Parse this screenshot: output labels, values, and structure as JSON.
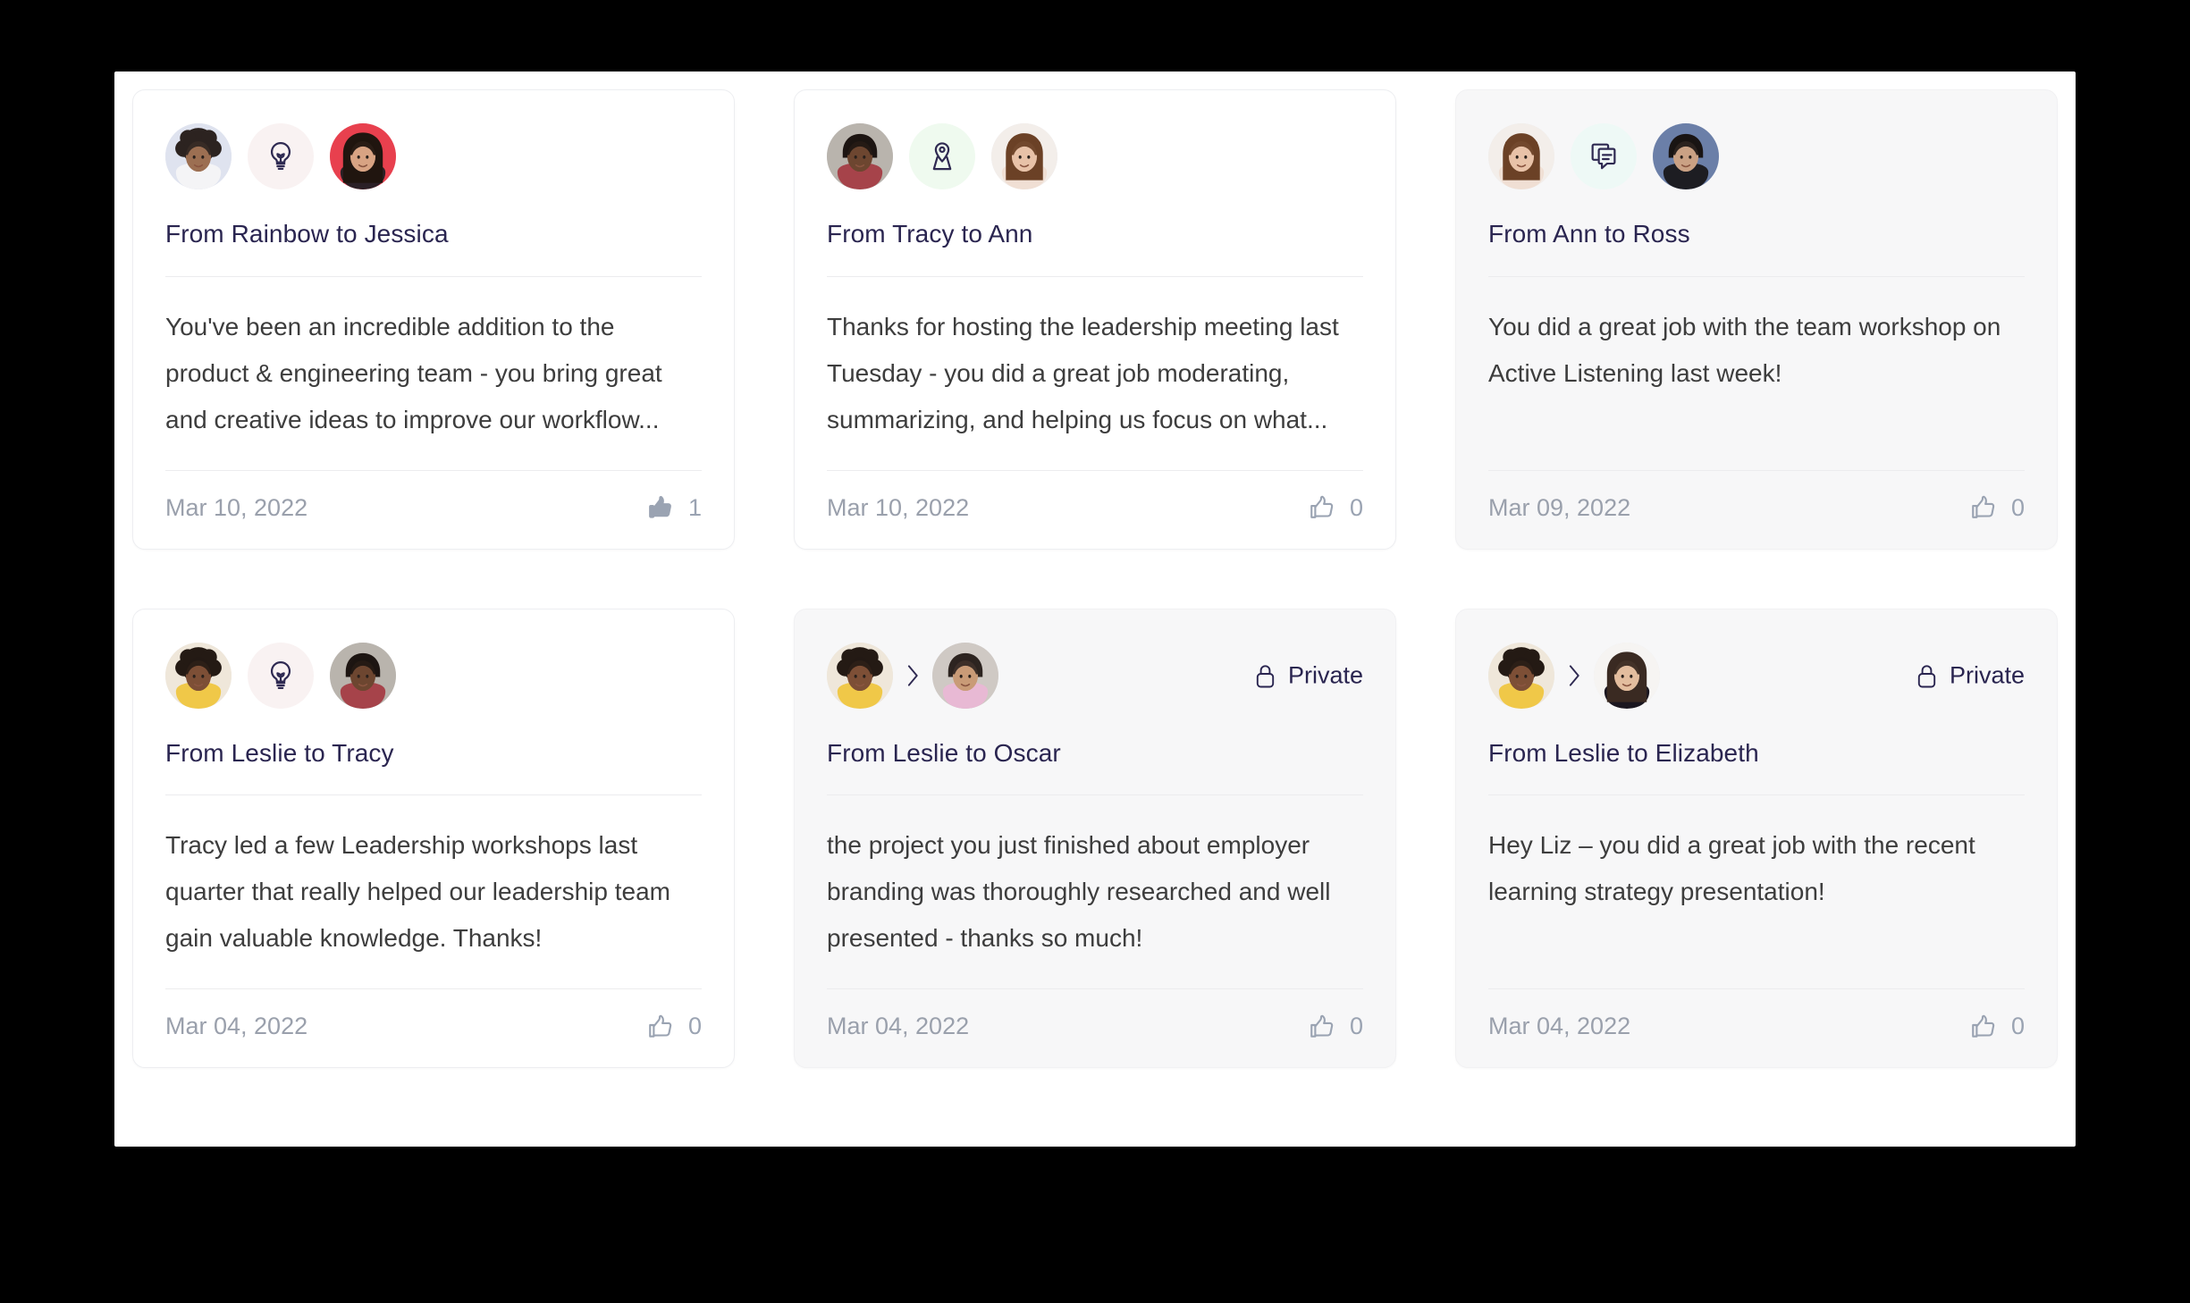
{
  "theme": {
    "page_background": "#000000",
    "panel_background": "#ffffff",
    "card_background": "#ffffff",
    "card_background_tinted": "#f7f7f8",
    "title_color": "#2a2550",
    "body_color": "#3d3d3d",
    "muted_color": "#9aa0ac",
    "like_color": "#9aa3b2"
  },
  "cards": [
    {
      "id": "card-rainbow-jessica",
      "title": "From Rainbow to Jessica",
      "body": "You've been an incredible addition to the product & engineering team - you bring great and creative ideas to improve our workflow...",
      "date": "Mar 10, 2022",
      "like_count": "1",
      "like_state": "liked",
      "like_icon": "thumbs-up-filled-icon",
      "badge_icon": "lightbulb-icon",
      "badge_bg": "#f9f2f2",
      "tinted": false,
      "private": false,
      "privacy_label": "",
      "separator_icon": "",
      "sender_avatar": "avatar-rainbow",
      "recipient_avatar": "avatar-jessica"
    },
    {
      "id": "card-tracy-ann",
      "title": "From Tracy to Ann",
      "body": "Thanks for hosting the leadership meeting last Tuesday - you did a great job moderating, summarizing, and helping us focus on what...",
      "date": "Mar 10, 2022",
      "like_count": "0",
      "like_state": "unliked",
      "like_icon": "thumbs-up-outline-icon",
      "badge_icon": "map-pin-icon",
      "badge_bg": "#effaef",
      "tinted": false,
      "private": false,
      "privacy_label": "",
      "separator_icon": "",
      "sender_avatar": "avatar-tracy",
      "recipient_avatar": "avatar-ann"
    },
    {
      "id": "card-ann-ross",
      "title": "From Ann to Ross",
      "body": "You did a great job with the team workshop on Active Listening last week!",
      "date": "Mar 09, 2022",
      "like_count": "0",
      "like_state": "unliked",
      "like_icon": "thumbs-up-outline-icon",
      "badge_icon": "chat-bubbles-icon",
      "badge_bg": "#eef9f6",
      "tinted": true,
      "private": false,
      "privacy_label": "",
      "separator_icon": "",
      "sender_avatar": "avatar-ann",
      "recipient_avatar": "avatar-ross"
    },
    {
      "id": "card-leslie-tracy",
      "title": "From Leslie to Tracy",
      "body": "Tracy led a few Leadership workshops last quarter that really helped our leadership team gain valuable knowledge. Thanks!",
      "date": "Mar 04, 2022",
      "like_count": "0",
      "like_state": "unliked",
      "like_icon": "thumbs-up-outline-icon",
      "badge_icon": "lightbulb-icon",
      "badge_bg": "#f9f2f2",
      "tinted": false,
      "private": false,
      "privacy_label": "",
      "separator_icon": "",
      "sender_avatar": "avatar-leslie",
      "recipient_avatar": "avatar-tracy"
    },
    {
      "id": "card-leslie-oscar",
      "title": "From Leslie to Oscar",
      "body": "the project you just finished about employer branding was thoroughly researched and well presented - thanks so much!",
      "date": "Mar 04, 2022",
      "like_count": "0",
      "like_state": "unliked",
      "like_icon": "thumbs-up-outline-icon",
      "badge_icon": "",
      "badge_bg": "",
      "tinted": true,
      "private": true,
      "privacy_label": "Private",
      "separator_icon": "chevron-right-icon",
      "sender_avatar": "avatar-leslie",
      "recipient_avatar": "avatar-oscar"
    },
    {
      "id": "card-leslie-elizabeth",
      "title": "From Leslie to Elizabeth",
      "body": "Hey Liz – you did a great job with the recent learning strategy presentation!",
      "date": "Mar 04, 2022",
      "like_count": "0",
      "like_state": "unliked",
      "like_icon": "thumbs-up-outline-icon",
      "badge_icon": "",
      "badge_bg": "",
      "tinted": true,
      "private": true,
      "privacy_label": "Private",
      "separator_icon": "chevron-right-icon",
      "sender_avatar": "avatar-leslie",
      "recipient_avatar": "avatar-elizabeth"
    }
  ]
}
